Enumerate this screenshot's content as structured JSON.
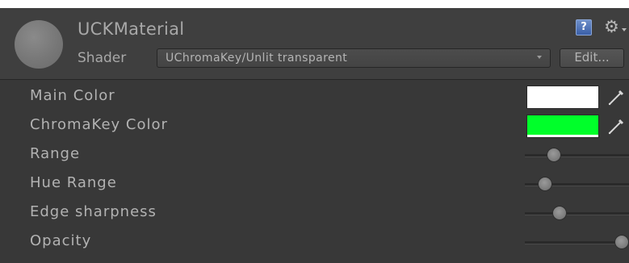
{
  "material": {
    "name": "UCKMaterial",
    "shader_label": "Shader",
    "shader_value": "UChromaKey/Unlit transparent",
    "edit_label": "Edit..."
  },
  "icons": {
    "help": "help-book-icon",
    "help_glyph": "?",
    "settings": "gear-icon",
    "settings_glyph": "⚙"
  },
  "properties": [
    {
      "label": "Main Color",
      "type": "color",
      "color": "#ffffff"
    },
    {
      "label": "ChromaKey Color",
      "type": "color",
      "color": "#00ff2a"
    },
    {
      "label": "Range",
      "type": "slider",
      "value": 0.28
    },
    {
      "label": "Hue Range",
      "type": "slider",
      "value": 0.19
    },
    {
      "label": "Edge sharpness",
      "type": "slider",
      "value": 0.33
    },
    {
      "label": "Opacity",
      "type": "slider",
      "value": 0.93
    }
  ],
  "colors": {
    "panel_bg": "#383838",
    "header_bg": "#3f3f3f",
    "text": "#b2b2b2"
  }
}
